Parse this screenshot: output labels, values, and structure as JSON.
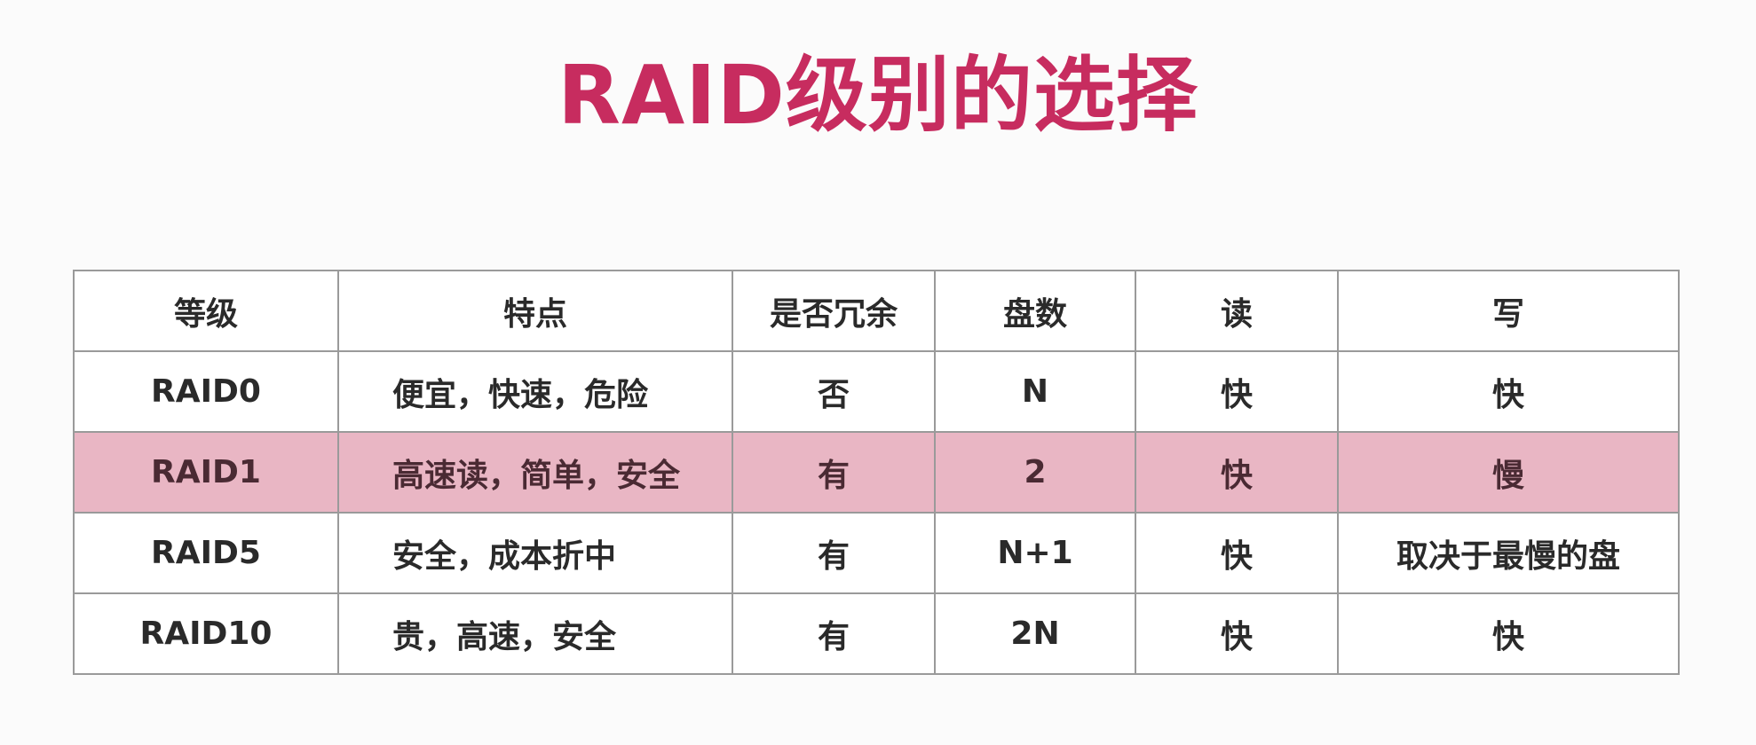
{
  "title": "RAID级别的选择",
  "table": {
    "headers": [
      "等级",
      "特点",
      "是否冗余",
      "盘数",
      "读",
      "写"
    ],
    "rows": [
      {
        "level": "RAID0",
        "feature": "便宜，快速，危险",
        "redundant": "否",
        "disks": "N",
        "read": "快",
        "write": "快",
        "highlighted": false
      },
      {
        "level": "RAID1",
        "feature": "高速读，简单，安全",
        "redundant": "有",
        "disks": "2",
        "read": "快",
        "write": "慢",
        "highlighted": true
      },
      {
        "level": "RAID5",
        "feature": "安全，成本折中",
        "redundant": "有",
        "disks": "N+1",
        "read": "快",
        "write": "取决于最慢的盘",
        "highlighted": false
      },
      {
        "level": "RAID10",
        "feature": "贵，高速，安全",
        "redundant": "有",
        "disks": "2N",
        "read": "快",
        "write": "快",
        "highlighted": false
      }
    ]
  },
  "colors": {
    "title": "#c72c5f",
    "highlight_row": "#e9b6c4",
    "border": "#9a9a9a",
    "background": "#fbfbfb"
  }
}
